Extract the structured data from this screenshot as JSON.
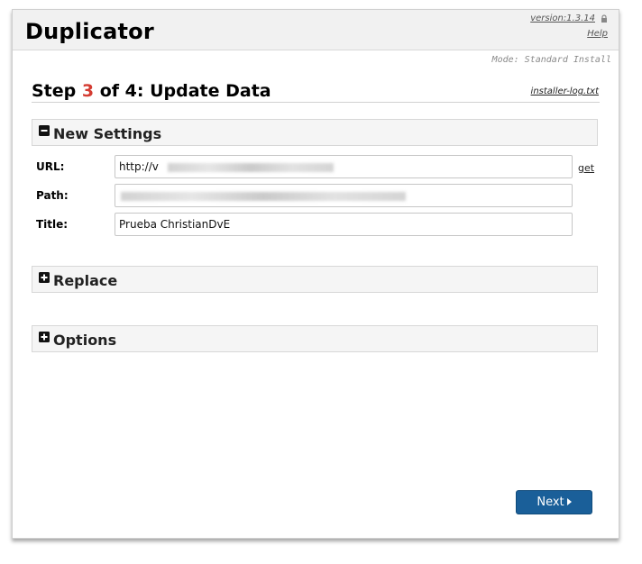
{
  "header": {
    "title": "Duplicator",
    "version": "version:1.3.14",
    "help": "Help",
    "lock_icon": "lock-icon"
  },
  "mode": "Mode: Standard Install",
  "step": {
    "prefix": "Step ",
    "number": "3",
    "suffix": " of 4: Update Data",
    "log_link": "installer-log.txt"
  },
  "sections": {
    "new_settings": {
      "label": "New Settings",
      "icon": "minus-square-icon",
      "expanded": true
    },
    "replace": {
      "label": "Replace",
      "icon": "plus-square-icon",
      "expanded": false
    },
    "options": {
      "label": "Options",
      "icon": "plus-square-icon",
      "expanded": false
    }
  },
  "fields": {
    "url": {
      "label": "URL:",
      "value": "http://v"
    },
    "path": {
      "label": "Path:",
      "value": ""
    },
    "title": {
      "label": "Title:",
      "value": "Prueba ChristianDvE"
    },
    "get_link": "get"
  },
  "buttons": {
    "next": "Next"
  },
  "colors": {
    "accent_step": "#d43c32",
    "button_bg": "#1a5f99"
  }
}
